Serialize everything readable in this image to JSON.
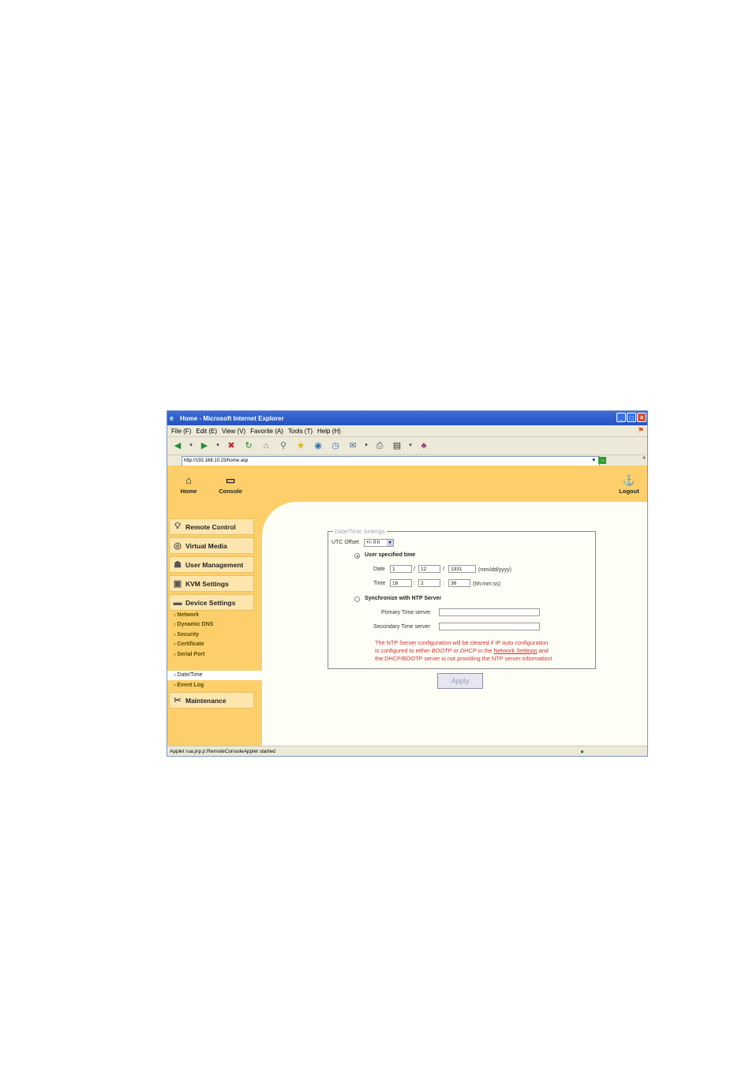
{
  "window": {
    "title": "Home - Microsoft Internet Explorer",
    "buttons": {
      "minimize": "_",
      "maximize": "□",
      "close": "×"
    }
  },
  "menu": [
    "File (F)",
    "Edit (E)",
    "View (V)",
    "Favorite (A)",
    "Tools (T)",
    "Help (H)"
  ],
  "address": {
    "url": "http://192.168.10.23/home.asp"
  },
  "topnav": {
    "home": "Home",
    "console": "Console",
    "logout": "Logout"
  },
  "sidebar": {
    "remote_control": "Remote Control",
    "virtual_media": "Virtual Media",
    "user_management": "User Management",
    "kvm_settings": "KVM Settings",
    "device_settings": "Device Settings",
    "subitems": [
      "Network",
      "Dynamic DNS",
      "Security",
      "Certificate",
      "Serial Port",
      "Date/Time",
      "Event Log"
    ],
    "maintenance": "Maintenance"
  },
  "form": {
    "legend": "Date/Time Settings",
    "utc_label": "UTC Offset",
    "utc_value": "+/- 0 h",
    "user_specified_label": "User specified time",
    "date_label": "Date",
    "date_month": "1",
    "date_day": "12",
    "date_year": "1931",
    "date_sep": "/",
    "date_format": "(mm/dd/yyyy)",
    "time_label": "Time",
    "time_hour": "16",
    "time_min": "2",
    "time_sec": "36",
    "time_sep": ":",
    "time_format": "(hh:mm:ss)",
    "ntp_label": "Synchronize with NTP Server",
    "primary_label": "Primary Time server",
    "primary_value": "",
    "secondary_label": "Secondary Time server",
    "secondary_value": "",
    "warning_1": "The NTP Server configuration will be cleared if IP auto configuration",
    "warning_2a": "is configured to either ",
    "warning_2b": "BOOTP",
    "warning_2c": " or ",
    "warning_2d": "DHCP",
    "warning_2e": " in the ",
    "warning_link": "Network Settings",
    "warning_2f": " and",
    "warning_3": "the DHCP/BOOTP server is not providing the NTP server information!",
    "apply": "Apply"
  },
  "status": {
    "text": "Applet rua.jnp.jr.RemoteConsoleApplet started"
  },
  "colors": {
    "page_bg": "#fccf6a",
    "content_bg": "#fffef6",
    "warning": "#d03030",
    "titlebar": "#2452c0"
  }
}
